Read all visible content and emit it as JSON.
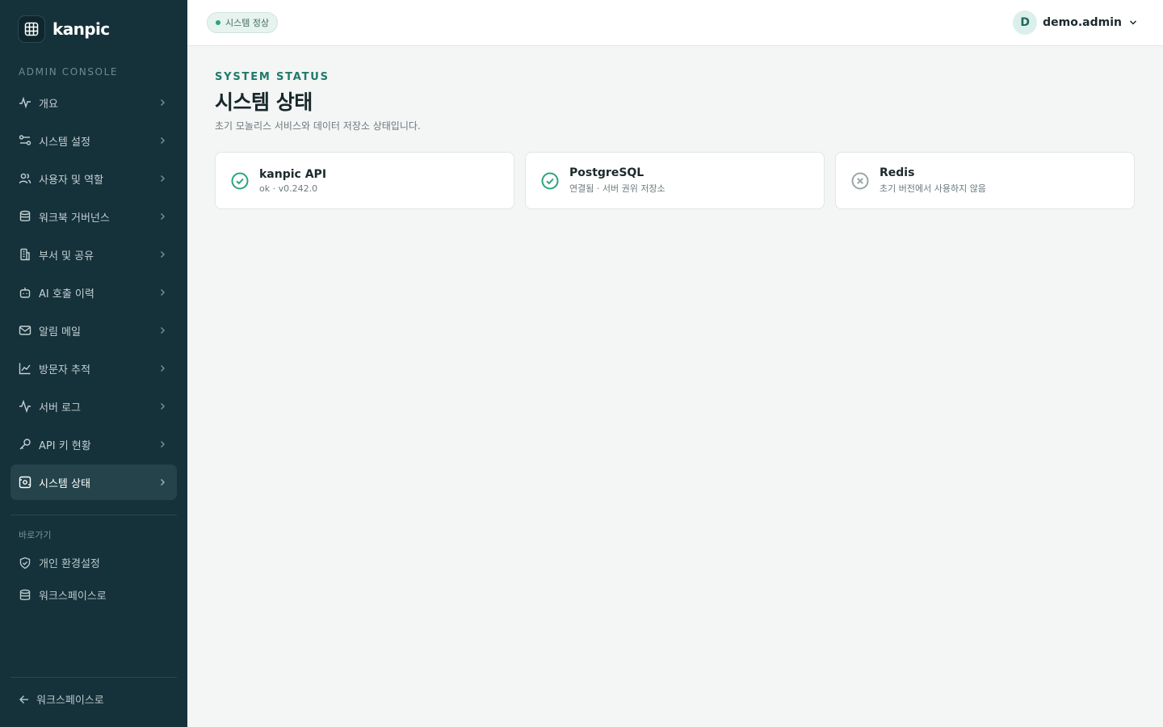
{
  "brand": {
    "name": "kanpic"
  },
  "sidebar": {
    "section_label": "ADMIN CONSOLE",
    "items": [
      {
        "label": "개요",
        "icon": "activity-icon"
      },
      {
        "label": "시스템 설정",
        "icon": "settings-icon"
      },
      {
        "label": "사용자 및 역할",
        "icon": "users-icon"
      },
      {
        "label": "워크북 거버넌스",
        "icon": "database-icon"
      },
      {
        "label": "부서 및 공유",
        "icon": "building-icon"
      },
      {
        "label": "AI 호출 이력",
        "icon": "bot-icon"
      },
      {
        "label": "알림 메일",
        "icon": "mail-icon"
      },
      {
        "label": "방문자 추적",
        "icon": "chart-icon"
      },
      {
        "label": "서버 로그",
        "icon": "pulse-icon"
      },
      {
        "label": "API 키 현황",
        "icon": "key-icon"
      },
      {
        "label": "시스템 상태",
        "icon": "server-icon",
        "active": true
      }
    ],
    "shortcuts_label": "바로가기",
    "shortcuts": [
      {
        "label": "개인 환경설정",
        "icon": "shield-icon"
      },
      {
        "label": "워크스페이스로",
        "icon": "database-icon"
      }
    ],
    "back_label": "워크스페이스로"
  },
  "topbar": {
    "status_pill": "시스템 정상",
    "user": {
      "initial": "D",
      "name": "demo.admin"
    }
  },
  "main": {
    "eyebrow": "SYSTEM STATUS",
    "title": "시스템 상태",
    "description": "초기 모놀리스 서비스와 데이터 저장소 상태입니다.",
    "services": [
      {
        "name": "kanpic API",
        "detail": "ok · v0.242.0",
        "status": "ok"
      },
      {
        "name": "PostgreSQL",
        "detail": "연결됨 · 서버 권위 저장소",
        "status": "ok"
      },
      {
        "name": "Redis",
        "detail": "초기 버전에서 사용하지 않음",
        "status": "disabled"
      }
    ]
  },
  "colors": {
    "sidebar_bg": "#15313a",
    "accent": "#1f7a6a",
    "ok": "#2aa57a",
    "disabled": "#9aa6a8"
  }
}
